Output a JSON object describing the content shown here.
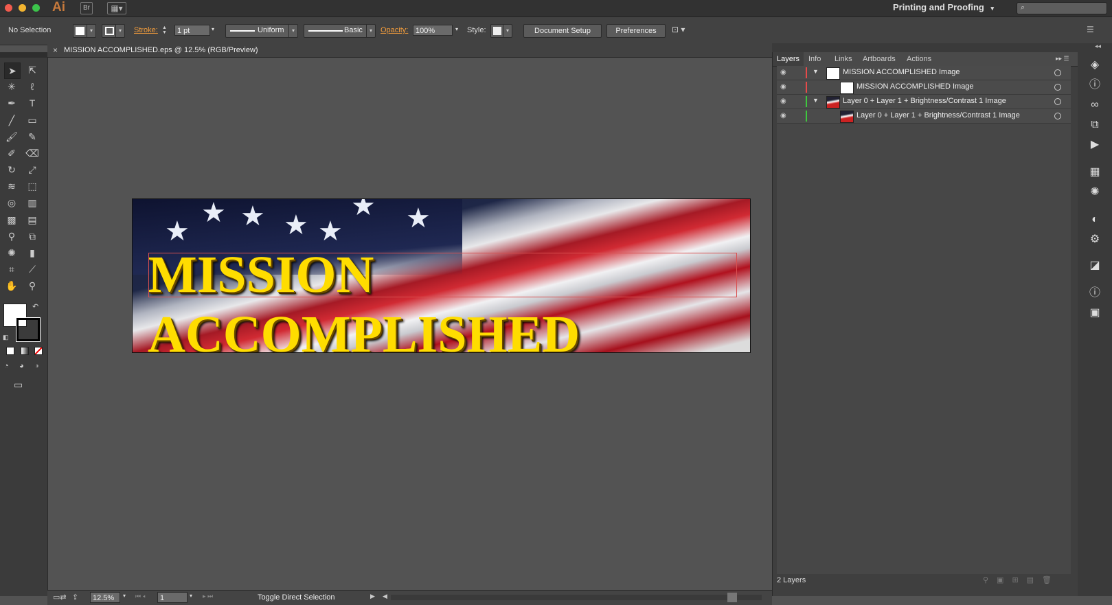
{
  "app": {
    "logo": "Ai",
    "bridge_label": "Br",
    "workspace": "Printing and Proofing",
    "workspace_arrow": "▾",
    "traffic_colors": [
      "#f15b4e",
      "#f2b430",
      "#3cc44b"
    ]
  },
  "control_bar": {
    "selection": "No Selection",
    "stroke_label": "Stroke:",
    "stroke_value": "1 pt",
    "profile": "Uniform",
    "brush": "Basic",
    "opacity_label": "Opacity:",
    "opacity_value": "100%",
    "style_label": "Style:",
    "document_setup": "Document Setup",
    "preferences": "Preferences"
  },
  "document": {
    "tab_title": "MISSION ACCOMPLISHED.eps @ 12.5% (RGB/Preview)",
    "close_glyph": "×",
    "banner_text": "MISSION ACCOMPLISHED"
  },
  "layers_panel": {
    "tabs": [
      "Layers",
      "Info",
      "Links",
      "Artboards",
      "Actions"
    ],
    "rows": [
      {
        "name": "MISSION ACCOMPLISHED Image",
        "color": "#e84a4a"
      },
      {
        "name": "MISSION ACCOMPLISHED Image",
        "color": "#e84a4a"
      },
      {
        "name": "Layer 0 + Layer 1 + Brightness/Contrast 1 Image",
        "color": "#3ec83e"
      },
      {
        "name": "Layer 0 + Layer 1 + Brightness/Contrast 1 Image",
        "color": "#3ec83e"
      }
    ],
    "count": "2 Layers"
  },
  "status_bar": {
    "zoom": "12.5%",
    "page": "1",
    "status_text": "Toggle Direct Selection"
  }
}
